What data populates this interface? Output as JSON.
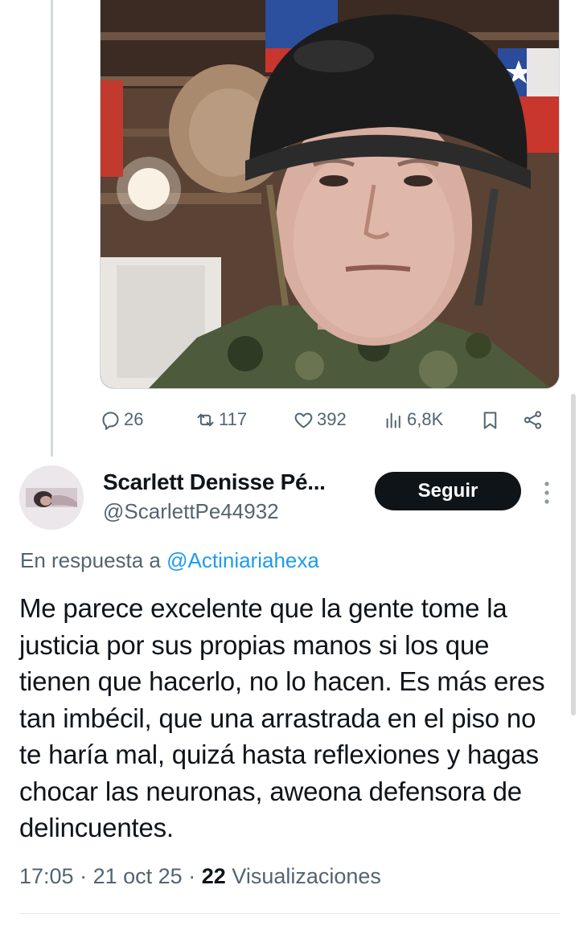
{
  "tweet_above": {
    "image_icon": "photo-soldier-helmet",
    "actions": {
      "replies": "26",
      "retweets": "117",
      "likes": "392",
      "views": "6,8K"
    }
  },
  "reply_tweet": {
    "display_name": "Scarlett Denisse Pé...",
    "handle": "@ScarlettPe44932",
    "follow_label": "Seguir",
    "in_reply_prefix": "En respuesta a",
    "in_reply_mention": "@Actiniariahexa",
    "text": "Me parece excelente que la gente tome la justicia por sus propias manos si los que tienen que hacerlo, no lo hacen. Es más eres tan imbécil, que una arrastrada en el piso no te haría mal, quizá hasta reflexiones y hagas chocar las neuronas, aweona defensora de delincuentes.",
    "time": "17:05",
    "date": "21 oct 25",
    "views_count": "22",
    "views_label": "Visualizaciones",
    "sep": "·"
  },
  "colors": {
    "text": "#0f1419",
    "secondary": "#536471",
    "link": "#1d9bf0",
    "button_bg": "#0f1419"
  }
}
